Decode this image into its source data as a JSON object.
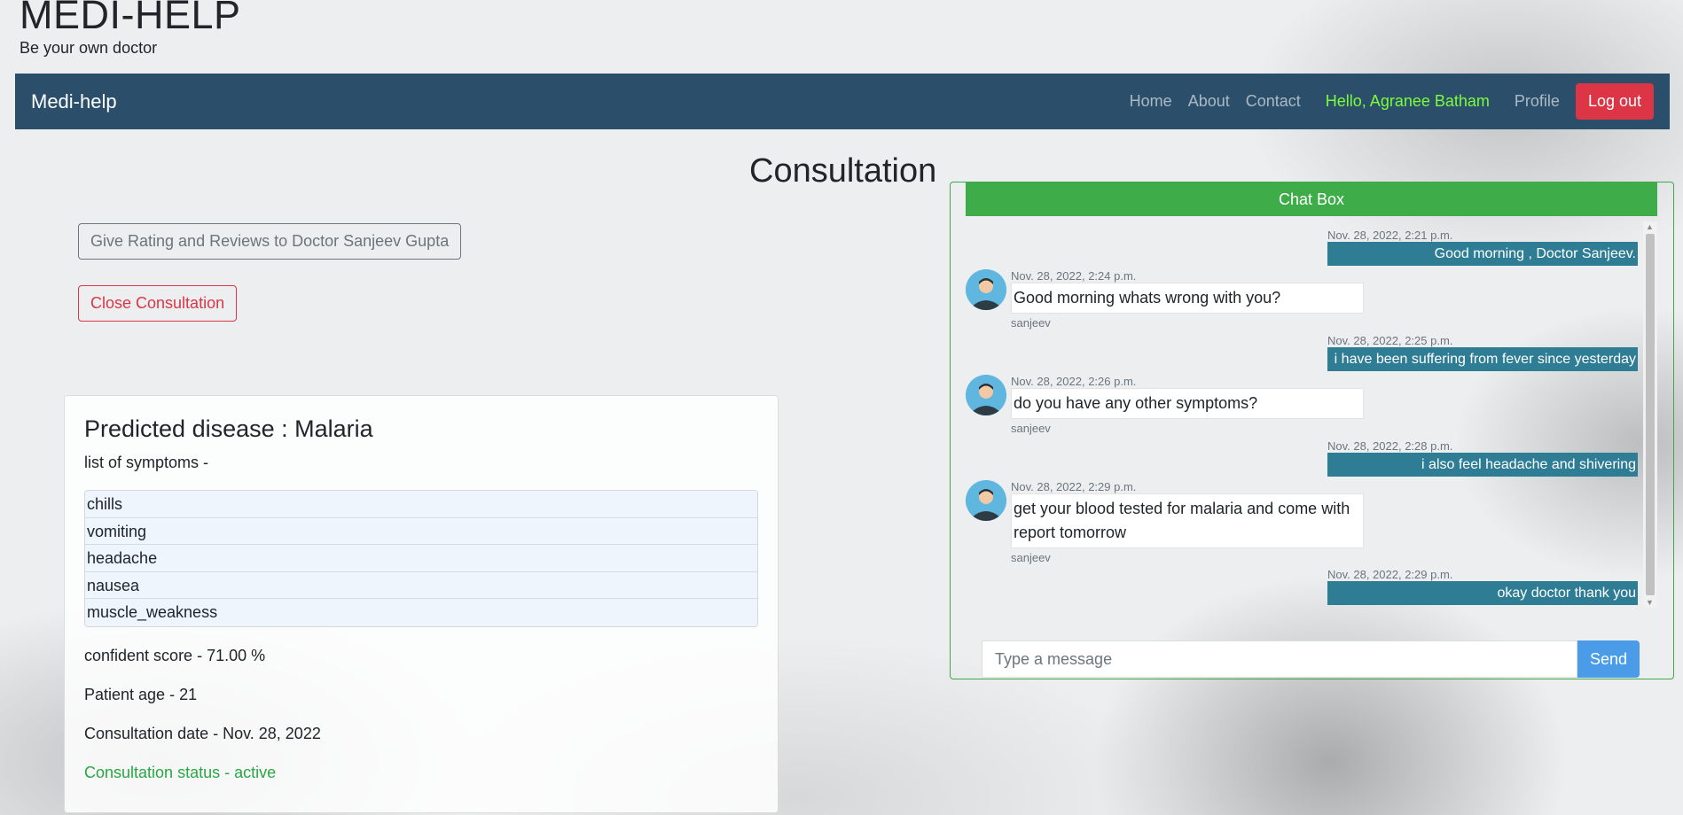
{
  "brand": {
    "title": "MEDI-HELP",
    "tagline": "Be your own doctor"
  },
  "navbar": {
    "brand": "Medi-help",
    "links": [
      "Home",
      "About",
      "Contact"
    ],
    "greeting": "Hello, Agranee Batham",
    "profile": "Profile",
    "logout": "Log out"
  },
  "page": {
    "title": "Consultation",
    "rating_button": "Give Rating and Reviews to Doctor Sanjeev Gupta",
    "close_button": "Close Consultation"
  },
  "prediction": {
    "title": "Predicted disease : Malaria",
    "symptoms_label": "list of symptoms -",
    "symptoms": [
      "chills",
      "vomiting",
      "headache",
      "nausea",
      "muscle_weakness"
    ],
    "confidence": "confident score - 71.00 %",
    "patient_age": "Patient age - 21",
    "date": "Consultation date - Nov. 28, 2022",
    "status": "Consultation status - active"
  },
  "chat": {
    "header": "Chat Box",
    "messages": [
      {
        "from": "me",
        "time": "Nov. 28, 2022, 2:21 p.m.",
        "text": "Good morning , Doctor Sanjeev."
      },
      {
        "from": "doctor",
        "time": "Nov. 28, 2022, 2:24 p.m.",
        "text": "Good morning whats wrong with you?",
        "sender": "sanjeev"
      },
      {
        "from": "me",
        "time": "Nov. 28, 2022, 2:25 p.m.",
        "text": "i have been suffering from fever since yesterday"
      },
      {
        "from": "doctor",
        "time": "Nov. 28, 2022, 2:26 p.m.",
        "text": "do you have any other symptoms?",
        "sender": "sanjeev"
      },
      {
        "from": "me",
        "time": "Nov. 28, 2022, 2:28 p.m.",
        "text": "i also feel headache and shivering"
      },
      {
        "from": "doctor",
        "time": "Nov. 28, 2022, 2:29 p.m.",
        "text": "get your blood tested for malaria and come with report tomorrow",
        "sender": "sanjeev"
      },
      {
        "from": "me",
        "time": "Nov. 28, 2022, 2:29 p.m.",
        "text": "okay doctor thank you"
      }
    ],
    "input_placeholder": "Type a message",
    "send": "Send"
  },
  "colors": {
    "navbar": "#2b4f6a",
    "greeting": "#7cfc3c",
    "logout": "#dc3545",
    "chat_header": "#3fac4a",
    "sent_bubble": "#2e7d95",
    "send_button": "#4a9be8",
    "status": "#28a745"
  },
  "icons": {
    "avatar": "doctor-avatar-icon",
    "scroll_up": "scroll-up-arrow-icon",
    "scroll_down": "scroll-down-arrow-icon"
  }
}
